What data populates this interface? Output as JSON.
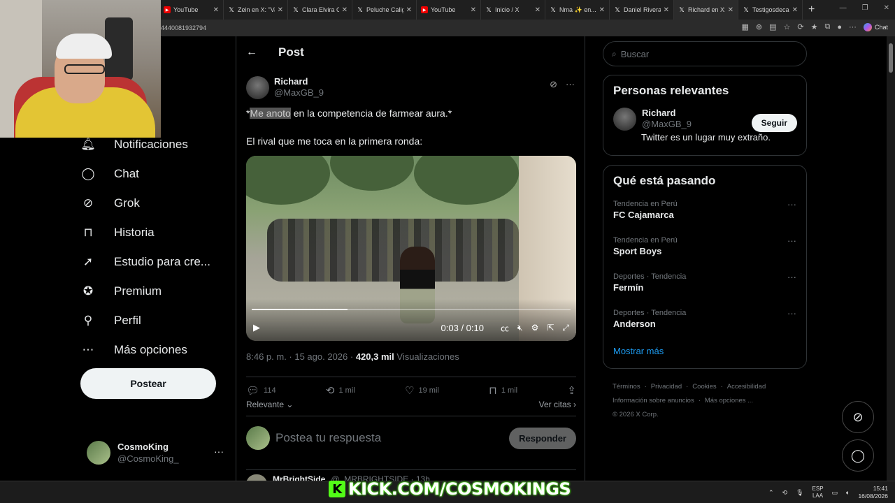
{
  "browser": {
    "tabs": [
      {
        "title": "YouTube",
        "icon": "youtube-icon",
        "active": false
      },
      {
        "title": "Zein en X: \"Var...",
        "icon": "x-logo-icon",
        "active": false
      },
      {
        "title": "Clara Elvira Osp...",
        "icon": "x-logo-icon",
        "active": false
      },
      {
        "title": "Peluche Caligar...",
        "icon": "x-logo-icon",
        "active": false
      },
      {
        "title": "YouTube",
        "icon": "youtube-icon",
        "active": false
      },
      {
        "title": "Inicio / X",
        "icon": "x-logo-icon",
        "active": false
      },
      {
        "title": "Nma ✨ en...",
        "icon": "x-logo-icon",
        "active": false
      },
      {
        "title": "Daniel Rivera S...",
        "icon": "x-logo-icon",
        "active": false
      },
      {
        "title": "Richard en X: \"...",
        "icon": "x-logo-icon",
        "active": true
      },
      {
        "title": "Testigosdecaido...",
        "icon": "x-logo-icon",
        "active": false
      }
    ],
    "url": "4440081932794",
    "chat_label": "Chat"
  },
  "nav": {
    "items": [
      {
        "label": "Notificaciones",
        "icon": "bell-icon"
      },
      {
        "label": "Chat",
        "icon": "chat-bubble-icon"
      },
      {
        "label": "Grok",
        "icon": "grok-icon"
      },
      {
        "label": "Historia",
        "icon": "bookmark-icon"
      },
      {
        "label": "Estudio para cre...",
        "icon": "rocket-icon"
      },
      {
        "label": "Premium",
        "icon": "verified-badge-icon"
      },
      {
        "label": "Perfil",
        "icon": "person-icon"
      },
      {
        "label": "Más opciones",
        "icon": "more-circle-icon"
      }
    ],
    "post_button": "Postear",
    "account": {
      "name": "CosmoKing",
      "handle": "@CosmoKing_"
    }
  },
  "post": {
    "header_title": "Post",
    "author_name": "Richard",
    "author_handle": "@MaxGB_9",
    "text_prefix": "*",
    "text_highlight": "Me anoto",
    "text_rest": " en la competencia de farmear aura.*",
    "text_line2": "El rival que me toca en la primera ronda:",
    "video": {
      "time": "0:03 / 0:10",
      "progress": 0.3
    },
    "timestamp": "8:46 p. m. · 15 ago. 2026 · ",
    "views_count": "420,3 mil",
    "views_label": " Visualizaciones",
    "stats": {
      "replies": "114",
      "reposts": "1 mil",
      "likes": "19 mil",
      "bookmarks": "1 mil"
    },
    "sort_label": "Relevante",
    "quotes_label": "Ver citas",
    "reply_placeholder": "Postea tu respuesta",
    "reply_button": "Responder",
    "next_reply": {
      "name": "MrBrightSide",
      "handle": "@_MRBRIGHTSIDE · 13h"
    }
  },
  "sidebar": {
    "search_placeholder": "Buscar",
    "relevant_title": "Personas relevantes",
    "relevant_person": {
      "name": "Richard",
      "handle": "@MaxGB_9",
      "bio": "Twitter es un lugar muy extraño.",
      "follow_label": "Seguir"
    },
    "trends_title": "Qué está pasando",
    "trends": [
      {
        "context": "Tendencia en Perú",
        "name": "FC Cajamarca"
      },
      {
        "context": "Tendencia en Perú",
        "name": "Sport Boys"
      },
      {
        "context": "Deportes · Tendencia",
        "name": "Fermín"
      },
      {
        "context": "Deportes · Tendencia",
        "name": "Anderson"
      }
    ],
    "show_more": "Mostrar más",
    "footer_links": [
      "Términos",
      "Privacidad",
      "Cookies",
      "Accesibilidad",
      "Información sobre anuncios",
      "Más opciones ..."
    ],
    "copyright": "© 2026 X Corp."
  },
  "overlay": {
    "kick_text": "KICK.COM/COSMOKINGS",
    "kick_logo": "K"
  },
  "taskbar": {
    "lang_top": "ESP",
    "lang_bottom": "LAA",
    "time": "15:41",
    "date": "16/08/2026"
  },
  "colors": {
    "accent": "#1d9bf0",
    "background": "#000000",
    "kick_green": "#53fc18"
  }
}
